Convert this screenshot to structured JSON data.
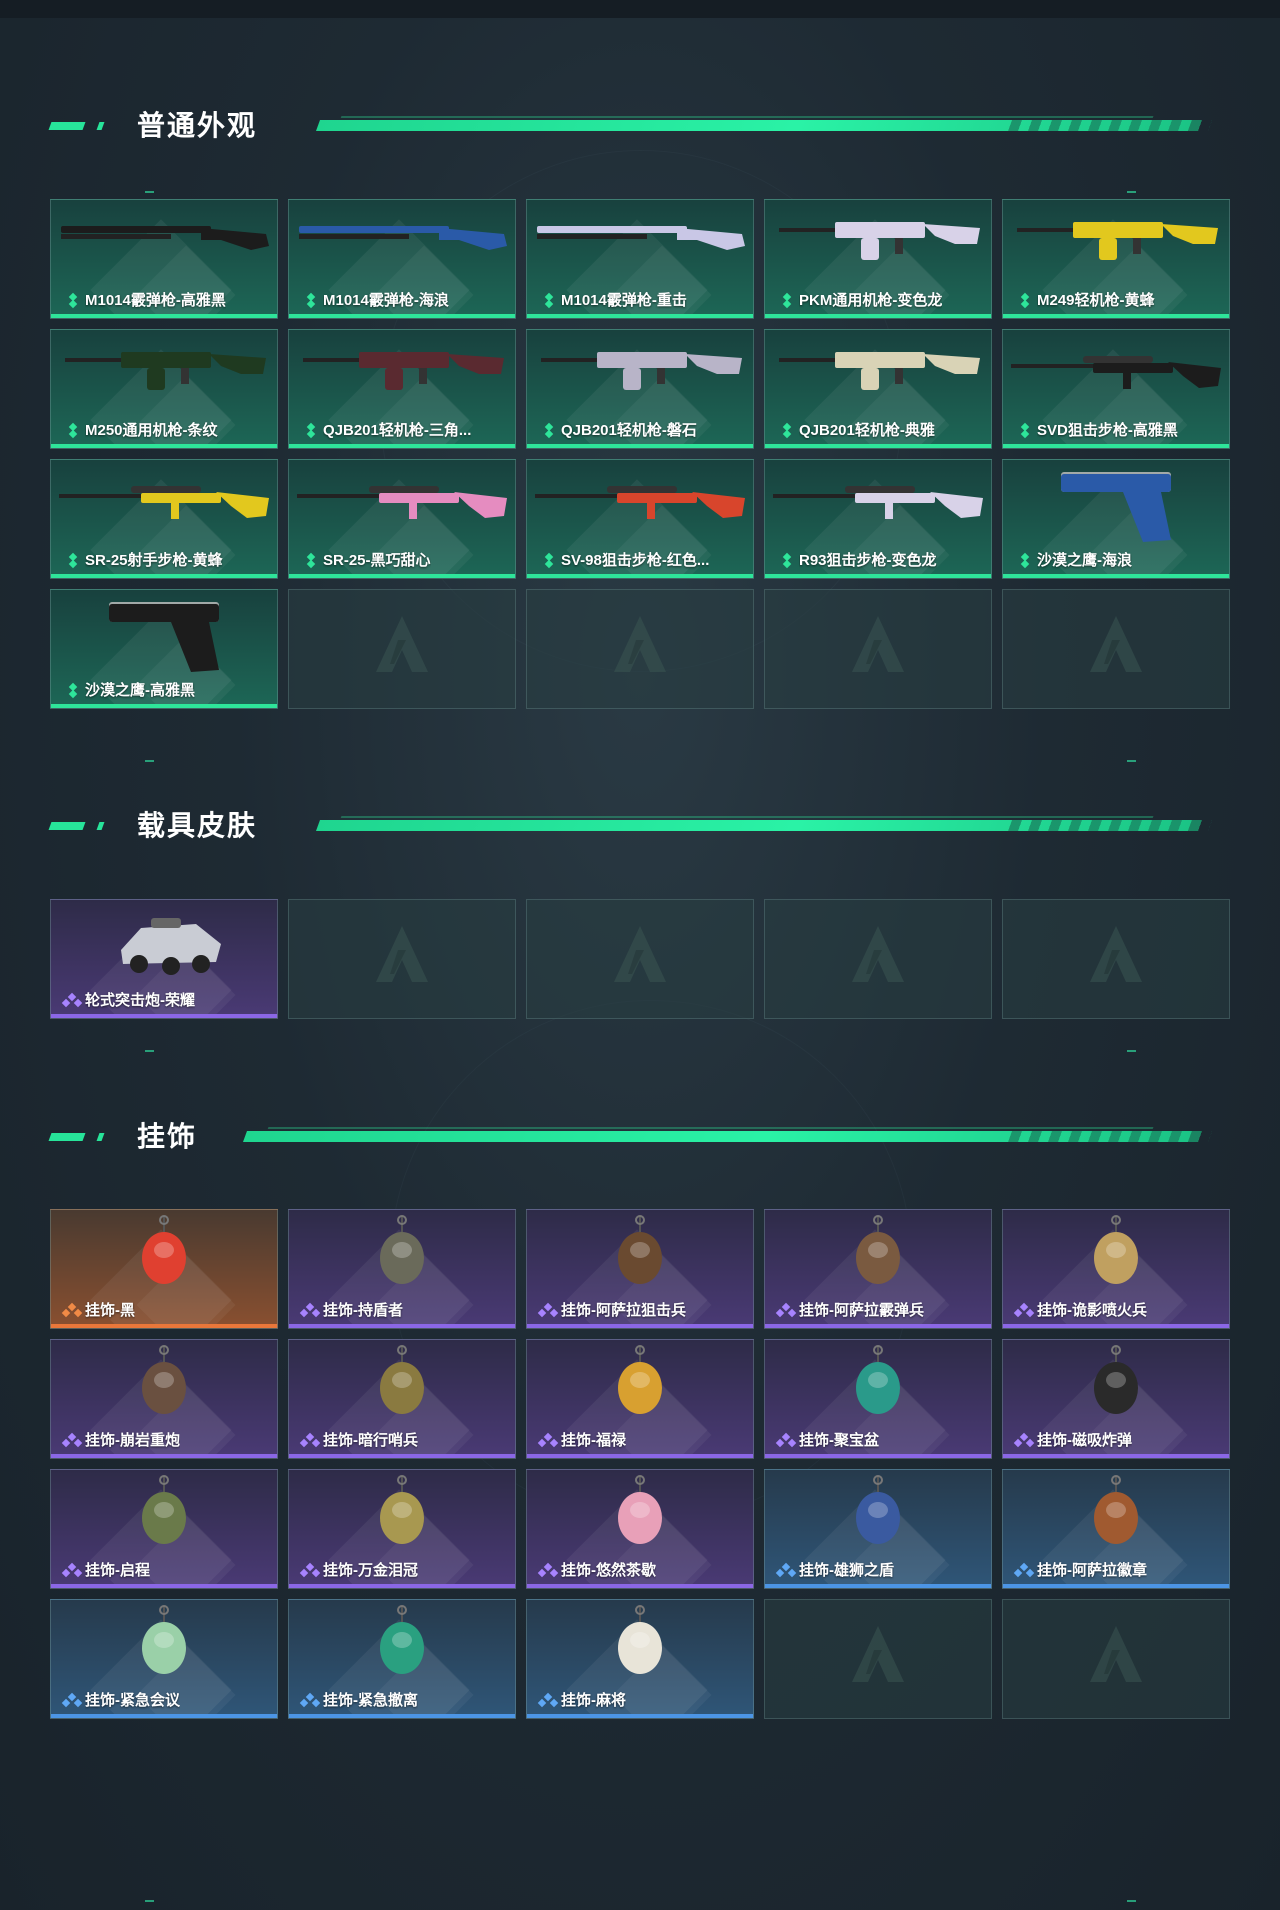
{
  "colors": {
    "accent": "#27e49a",
    "rarity_green": "#2ee59a",
    "rarity_purple": "#8b67e6",
    "rarity_orange": "#e9773a",
    "rarity_blue": "#4c95e5"
  },
  "sections": [
    {
      "title": "普通外观",
      "items": [
        {
          "label": "M1014霰弹枪-高雅黑",
          "rarity": "green",
          "icon": "shotgun-icon",
          "art": "#1c1c1c"
        },
        {
          "label": "M1014霰弹枪-海浪",
          "rarity": "green",
          "icon": "shotgun-icon",
          "art": "#2a5aa8"
        },
        {
          "label": "M1014霰弹枪-重击",
          "rarity": "green",
          "icon": "shotgun-icon",
          "art": "#c9c7e6"
        },
        {
          "label": "PKM通用机枪-变色龙",
          "rarity": "green",
          "icon": "machine-gun-icon",
          "art": "#d8d2e8"
        },
        {
          "label": "M249轻机枪-黄蜂",
          "rarity": "green",
          "icon": "machine-gun-icon",
          "art": "#e2c81e"
        },
        {
          "label": "M250通用机枪-条纹",
          "rarity": "green",
          "icon": "machine-gun-icon",
          "art": "#1f3a20"
        },
        {
          "label": "QJB201轻机枪-三角...",
          "rarity": "green",
          "icon": "machine-gun-icon",
          "art": "#5a2a30"
        },
        {
          "label": "QJB201轻机枪-磐石",
          "rarity": "green",
          "icon": "machine-gun-icon",
          "art": "#b8b4c8"
        },
        {
          "label": "QJB201轻机枪-典雅",
          "rarity": "green",
          "icon": "machine-gun-icon",
          "art": "#d9d3b6"
        },
        {
          "label": "SVD狙击步枪-高雅黑",
          "rarity": "green",
          "icon": "sniper-rifle-icon",
          "art": "#1c1c1c"
        },
        {
          "label": "SR-25射手步枪-黄蜂",
          "rarity": "green",
          "icon": "marksman-rifle-icon",
          "art": "#e2c81e"
        },
        {
          "label": "SR-25-黑巧甜心",
          "rarity": "green",
          "icon": "marksman-rifle-icon",
          "art": "#e58cc0"
        },
        {
          "label": "SV-98狙击步枪-红色...",
          "rarity": "green",
          "icon": "sniper-rifle-icon",
          "art": "#d8452c"
        },
        {
          "label": "R93狙击步枪-变色龙",
          "rarity": "green",
          "icon": "sniper-rifle-icon",
          "art": "#d8d2e8"
        },
        {
          "label": "沙漠之鹰-海浪",
          "rarity": "green",
          "icon": "pistol-icon",
          "art": "#2a5aa8"
        },
        {
          "label": "沙漠之鹰-高雅黑",
          "rarity": "green",
          "icon": "pistol-icon",
          "art": "#1c1c1c"
        }
      ],
      "empty_slots": 4
    },
    {
      "title": "载具皮肤",
      "items": [
        {
          "label": "轮式突击炮-荣耀",
          "rarity": "purple",
          "icon": "vehicle-icon",
          "art": "#c9ccd4"
        }
      ],
      "empty_slots": 4
    },
    {
      "title": "挂饰",
      "items": [
        {
          "label": "挂饰-黑",
          "rarity": "orange",
          "icon": "charm-icon",
          "art": "#e04030"
        },
        {
          "label": "挂饰-持盾者",
          "rarity": "purple",
          "icon": "charm-icon",
          "art": "#6a6a5a"
        },
        {
          "label": "挂饰-阿萨拉狙击兵",
          "rarity": "purple",
          "icon": "charm-icon",
          "art": "#6a4a30"
        },
        {
          "label": "挂饰-阿萨拉霰弹兵",
          "rarity": "purple",
          "icon": "charm-icon",
          "art": "#7a5a40"
        },
        {
          "label": "挂饰-诡影喷火兵",
          "rarity": "purple",
          "icon": "charm-icon",
          "art": "#c0a060"
        },
        {
          "label": "挂饰-崩岩重炮",
          "rarity": "purple",
          "icon": "charm-icon",
          "art": "#6a5040"
        },
        {
          "label": "挂饰-暗行哨兵",
          "rarity": "purple",
          "icon": "charm-icon",
          "art": "#8a7a40"
        },
        {
          "label": "挂饰-福禄",
          "rarity": "purple",
          "icon": "charm-icon",
          "art": "#d8a030"
        },
        {
          "label": "挂饰-聚宝盆",
          "rarity": "purple",
          "icon": "charm-icon",
          "art": "#2a9a8a"
        },
        {
          "label": "挂饰-磁吸炸弹",
          "rarity": "purple",
          "icon": "charm-icon",
          "art": "#2a2a2a"
        },
        {
          "label": "挂饰-启程",
          "rarity": "purple",
          "icon": "charm-icon",
          "art": "#6a7a4a"
        },
        {
          "label": "挂饰-万金泪冠",
          "rarity": "purple",
          "icon": "charm-icon",
          "art": "#a89850"
        },
        {
          "label": "挂饰-悠然茶歇",
          "rarity": "purple",
          "icon": "charm-icon",
          "art": "#e8a0b8"
        },
        {
          "label": "挂饰-雄狮之盾",
          "rarity": "blue",
          "icon": "charm-icon",
          "art": "#3a5aa0"
        },
        {
          "label": "挂饰-阿萨拉徽章",
          "rarity": "blue",
          "icon": "charm-icon",
          "art": "#a05a30"
        },
        {
          "label": "挂饰-紧急会议",
          "rarity": "blue",
          "icon": "charm-icon",
          "art": "#9ad0a8"
        },
        {
          "label": "挂饰-紧急撤离",
          "rarity": "blue",
          "icon": "charm-icon",
          "art": "#2aa080"
        },
        {
          "label": "挂饰-麻将",
          "rarity": "blue",
          "icon": "charm-icon",
          "art": "#e8e4d8"
        }
      ],
      "empty_slots": 2
    }
  ]
}
